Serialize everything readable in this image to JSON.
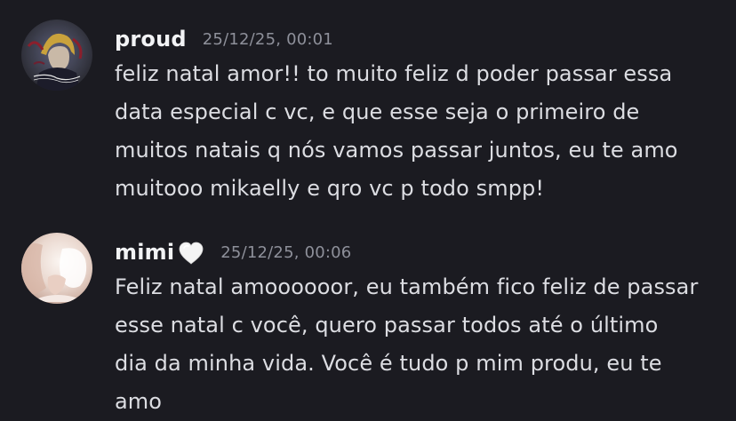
{
  "messages": [
    {
      "author": "proud",
      "timestamp": "25/12/25, 00:01",
      "text": "feliz natal amor!! to muito feliz d poder passar essa\ndata especial c vc, e que esse seja o primeiro de\nmuitos natais q nós vamos passar juntos, eu te amo\nmuitooo mikaelly e qro vc p todo smpp!"
    },
    {
      "author": "mimi",
      "author_badge": "white-heart-emoji",
      "timestamp": "25/12/25, 00:06",
      "text": "Feliz natal amoooooor, eu também fico feliz de passar\nesse natal c você, quero passar todos até o último\ndia da minha vida. Você é tudo p mim produ, eu te\namo"
    }
  ],
  "colors": {
    "background": "#1b1b21",
    "username": "#f2f3f5",
    "timestamp": "#8e909a",
    "message_text": "#dcdde2"
  }
}
